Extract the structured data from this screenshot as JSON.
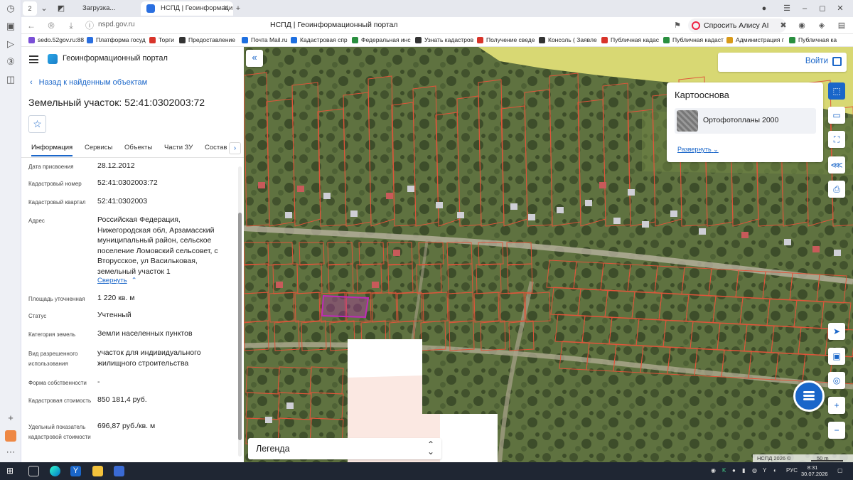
{
  "browser": {
    "tab_counter": "2",
    "tabs": [
      {
        "label": "Загрузка..."
      },
      {
        "label": "НСПД | Геоинформаци"
      }
    ],
    "url": "nspd.gov.ru",
    "page_title": "НСПД | Геоинформационный портал",
    "alice_button": "Спросить Алису AI",
    "bookmarks": [
      {
        "label": "sedo.52gov.ru:88",
        "color": "#7a4fd6"
      },
      {
        "label": "Платформа госуд",
        "color": "#2a6fe0"
      },
      {
        "label": "Торги",
        "color": "#d8342a"
      },
      {
        "label": "Предоставление",
        "color": "#333333"
      },
      {
        "label": "Почта Mail.ru",
        "color": "#1e6fe0"
      },
      {
        "label": "Кадастровая спр",
        "color": "#1e6fe0"
      },
      {
        "label": "Федеральная инс",
        "color": "#2a8f3f"
      },
      {
        "label": "Узнать кадастров",
        "color": "#333333"
      },
      {
        "label": "Получение сведе",
        "color": "#d8342a"
      },
      {
        "label": "Консоль ( Заявле",
        "color": "#333333"
      },
      {
        "label": "Публичная кадас",
        "color": "#d8342a"
      },
      {
        "label": "Публичная кадаст",
        "color": "#2a8f3f"
      },
      {
        "label": "Администрация г",
        "color": "#d89a1a"
      },
      {
        "label": "Публичная ка",
        "color": "#2a8f3f"
      }
    ]
  },
  "app": {
    "title": "Геоинформационный портал",
    "back_link": "Назад к найденным объектам",
    "object_title": "Земельный участок: 52:41:0302003:72",
    "tabs": [
      "Информация",
      "Сервисы",
      "Объекты",
      "Части ЗУ",
      "Состав"
    ],
    "properties": [
      {
        "key": "Дата присвоения",
        "value": "28.12.2012"
      },
      {
        "key": "Кадастровый номер",
        "value": "52:41:0302003:72"
      },
      {
        "key": "Кадастровый квартал",
        "value": "52:41:0302003"
      },
      {
        "key": "Адрес",
        "value": "Российская Федерация, Нижегородская обл, Арзамасский муниципальный район, сельское поселение Ломовский сельсовет, с Вторусское, ул Васильковая, земельный участок 1"
      },
      {
        "key": "Площадь уточненная",
        "value": "1 220 кв. м"
      },
      {
        "key": "Статус",
        "value": "Учтенный"
      },
      {
        "key": "Категория земель",
        "value": "Земли населенных пунктов"
      },
      {
        "key": "Вид разрешенного использования",
        "value": "участок для индивидуального жилищного строительства"
      },
      {
        "key": "Форма собственности",
        "value": "-"
      },
      {
        "key": "Кадастровая стоимость",
        "value": "850 181,4 руб."
      },
      {
        "key": "Удельный показатель кадастровой стоимости",
        "value": "696,87 руб./кв. м"
      }
    ],
    "collapse_link": "Свернуть"
  },
  "map": {
    "login_label": "Войти",
    "basemap_title": "Картооснова",
    "basemap_item": "Ортофотопланы 2000",
    "expand_link": "Развернуть",
    "legend_label": "Легенда",
    "attribution": "НСПД 2026 ©",
    "scale": "50 m",
    "parcel_color": "#e0553a",
    "selected_parcel_color": "#c02ab8"
  },
  "taskbar": {
    "language": "РУС",
    "time": "8:31",
    "date": "30.07.2026"
  }
}
